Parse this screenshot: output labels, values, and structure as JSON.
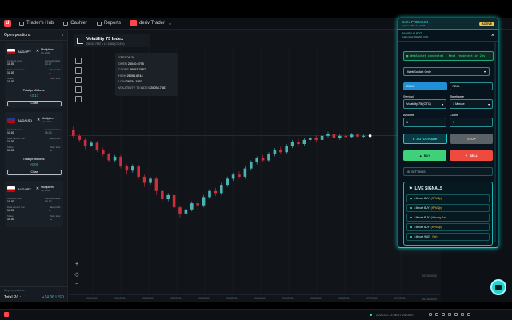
{
  "topnav": {
    "traders_hub": "Trader's Hub",
    "cashier": "Cashier",
    "reports": "Reports",
    "dtrader": "deriv Trader"
  },
  "positions": {
    "title": "Open positions",
    "cards": [
      {
        "symbol": "AUD/JPY",
        "contract": "Multipliers",
        "sub": "Up x100",
        "label_cost": "Contract cost:",
        "cost": "10.00",
        "label_value": "Contract value:",
        "value": "13.17",
        "label_tp": "Take profit:",
        "tp": "–",
        "label_deal": "Deal cancel. fee:",
        "deal": "10.00",
        "label_stake": "Stake:",
        "stake": "10.00",
        "label_sl": "Stop loss:",
        "sl": "–",
        "total_label": "Total profit/loss:",
        "total": "+3.17",
        "close": "Close"
      },
      {
        "symbol": "AUD/USD",
        "contract": "Multipliers",
        "sub": "Up x100",
        "label_cost": "Contract cost:",
        "cost": "10.00",
        "label_value": "Contract value:",
        "value": "16.06",
        "label_tp": "Take profit:",
        "tp": "–",
        "label_deal": "Deal cancel. fee:",
        "deal": "10.00",
        "label_stake": "Stake:",
        "stake": "10.00",
        "label_sl": "Stop loss:",
        "sl": "–",
        "total_label": "Total profit/loss:",
        "total": "+6.06",
        "close": "Close"
      },
      {
        "symbol": "AUD/JPY",
        "contract": "Multipliers",
        "sub": "Up x100",
        "label_cost": "Contract cost:",
        "cost": "10.00",
        "label_value": "Contract value:",
        "value": "15.13",
        "label_tp": "Take profit:",
        "tp": "–",
        "label_deal": "Deal cancel. fee:",
        "deal": "10.00",
        "label_stake": "Stake:",
        "stake": "10.00",
        "label_sl": "Stop loss:",
        "sl": "–",
        "total_label": "",
        "total": "",
        "close": ""
      }
    ],
    "open_count": "6 open positions",
    "total_label": "Total P/L:",
    "total_value": "+14.36 USD"
  },
  "chart": {
    "instrument": "Volatility 75 Index",
    "instrument_sub": "26034.7587 • 12.2868 (0.04%)",
    "ohlc": {
      "date": "13/02 06:26",
      "open_label": "OPEN",
      "open": "26040.6795",
      "close_label": "CLOSE",
      "close": "26053.7687",
      "high_label": "HIGH",
      "high": "26055.6744",
      "low_label": "LOW",
      "low": "26034.1552",
      "index_label": "VOLATILITY 75 INDEX",
      "index": "26053.7687"
    },
    "time_labels": [
      "06:10:00",
      "06:15:00",
      "06:20:00",
      "06:25:00",
      "06:30:00",
      "06:35:00",
      "06:40:00",
      "06:45:00",
      "06:50:00",
      "06:55:00",
      "07:00:00",
      "07:05:00"
    ],
    "price_label": "26700.0000",
    "price_label2": "26730.0000"
  },
  "chart_data": {
    "type": "candlestick",
    "title": "Volatility 75 Index",
    "candles": [
      [
        26110,
        26095,
        26120,
        26090
      ],
      [
        26095,
        26085,
        26100,
        26080
      ],
      [
        26085,
        26070,
        26090,
        26062
      ],
      [
        26070,
        26078,
        26083,
        26068
      ],
      [
        26078,
        26060,
        26082,
        26055
      ],
      [
        26060,
        26050,
        26066,
        26045
      ],
      [
        26050,
        26035,
        26054,
        26030
      ],
      [
        26035,
        26044,
        26048,
        26030
      ],
      [
        26044,
        26020,
        26048,
        26015
      ],
      [
        26020,
        26010,
        26025,
        26000
      ],
      [
        26010,
        26020,
        26025,
        26005
      ],
      [
        26020,
        25995,
        26024,
        25990
      ],
      [
        25995,
        25980,
        26000,
        25970
      ],
      [
        25980,
        25990,
        25995,
        25975
      ],
      [
        25990,
        25960,
        25995,
        25950
      ],
      [
        25960,
        25940,
        25965,
        25930
      ],
      [
        25940,
        25950,
        25955,
        25935
      ],
      [
        25950,
        25920,
        25955,
        25910
      ],
      [
        25920,
        25905,
        25925,
        25895
      ],
      [
        25905,
        25915,
        25920,
        25900
      ],
      [
        25915,
        25930,
        25935,
        25910
      ],
      [
        25930,
        25925,
        25938,
        25915
      ],
      [
        25925,
        25945,
        25950,
        25920
      ],
      [
        25945,
        25960,
        25965,
        25940
      ],
      [
        25960,
        25955,
        25968,
        25948
      ],
      [
        25955,
        25975,
        25980,
        25950
      ],
      [
        25975,
        25990,
        25995,
        25970
      ],
      [
        25990,
        26000,
        26005,
        25985
      ],
      [
        26000,
        25995,
        26008,
        25990
      ],
      [
        25995,
        26015,
        26020,
        25990
      ],
      [
        26015,
        26030,
        26035,
        26010
      ],
      [
        26030,
        26040,
        26045,
        26025
      ],
      [
        26040,
        26035,
        26048,
        26030
      ],
      [
        26035,
        26050,
        26055,
        26030
      ],
      [
        26050,
        26060,
        26065,
        26045
      ],
      [
        26060,
        26055,
        26068,
        26050
      ],
      [
        26055,
        26070,
        26075,
        26050
      ],
      [
        26070,
        26080,
        26085,
        26065
      ],
      [
        26080,
        26075,
        26088,
        26070
      ],
      [
        26075,
        26085,
        26090,
        26070
      ],
      [
        26085,
        26090,
        26095,
        26080
      ],
      [
        26090,
        26085,
        26096,
        26078
      ],
      [
        26085,
        26095,
        26100,
        26080
      ],
      [
        26095,
        26100,
        26105,
        26090
      ],
      [
        26100,
        26090,
        26104,
        26085
      ],
      [
        26090,
        26095,
        26100,
        26085
      ],
      [
        26095,
        26092,
        26100,
        26088
      ],
      [
        26092,
        26098,
        26102,
        26089
      ],
      [
        26098,
        26093,
        26102,
        26090
      ],
      [
        26093,
        26095,
        26098,
        26090
      ]
    ],
    "xlabel": "",
    "ylabel": ""
  },
  "bot": {
    "premium": "Deriv PREMIUM",
    "expires": "Expires: Mar 17, 2026",
    "active": "ACTIVE",
    "brand": "BINARY AI BOT",
    "auth": "Authorized (DEMO) USD",
    "ws": "WebSocket connected - Next reconnect in 25s",
    "mode": "WebSocket Only",
    "demo": "DEMO",
    "real": "REAL",
    "symbol_label": "Symbol",
    "symbol": "Volatility 75 (OTC)",
    "tf_label": "Timeframe",
    "tf": "1 Minute",
    "amount_label": "Amount",
    "amount": "1",
    "count_label": "Count",
    "count": "1",
    "auto": "AUTO TRADE",
    "stop": "STOP",
    "buy": "BUY",
    "sell": "SELL",
    "settings": "SETTINGS",
    "signals_title": "LIVE SIGNALS",
    "signals": [
      {
        "text": "1 Minute BUY",
        "tag": "(RPM 2p)"
      },
      {
        "text": "1 Minute BUY",
        "tag": "(RPM 2p)"
      },
      {
        "text": "1 Minute BUY",
        "tag": "(Winning Bar)"
      },
      {
        "text": "1 Minute BUY",
        "tag": "(RPM 2p)"
      },
      {
        "text": "1 Minute WAIT",
        "tag": "(Tie)"
      },
      {
        "text": "10 Minute BUY",
        "tag": "(RPM 2p)"
      }
    ]
  },
  "status": {
    "time": "2026-02-13 06:57:20 GMT"
  }
}
